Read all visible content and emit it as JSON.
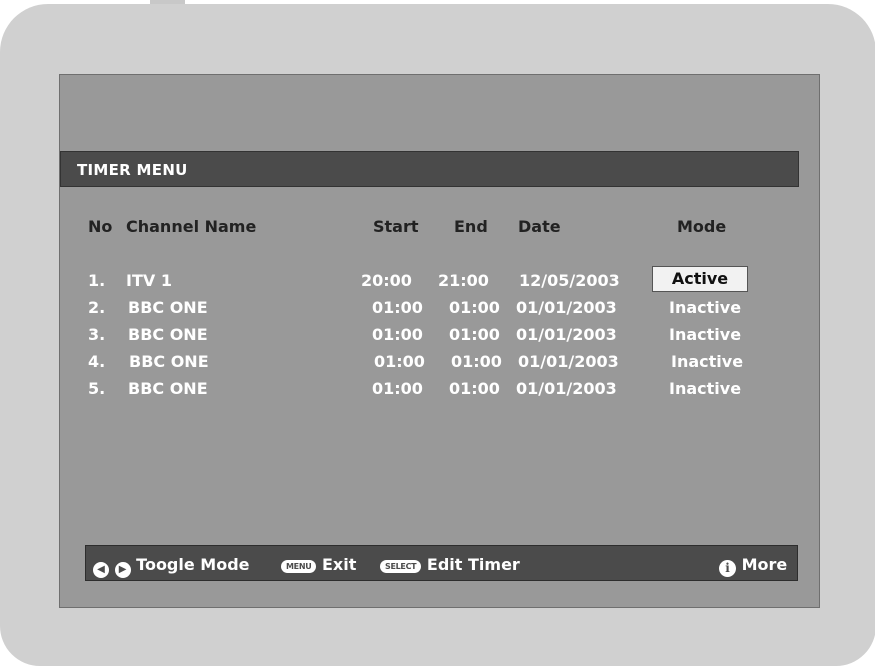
{
  "menu": {
    "title": "TIMER MENU"
  },
  "columns": {
    "no": "No",
    "channel": "Channel Name",
    "start": "Start",
    "end": "End",
    "date": "Date",
    "mode": "Mode"
  },
  "rows": [
    {
      "no": "1.",
      "channel": "ITV 1",
      "start": "20:00",
      "end": "21:00",
      "date": "12/05/2003",
      "mode": "Active"
    },
    {
      "no": "2.",
      "channel": "BBC ONE",
      "start": "01:00",
      "end": "01:00",
      "date": "01/01/2003",
      "mode": "Inactive"
    },
    {
      "no": "3.",
      "channel": "BBC ONE",
      "start": "01:00",
      "end": "01:00",
      "date": "01/01/2003",
      "mode": "Inactive"
    },
    {
      "no": "4.",
      "channel": "BBC ONE",
      "start": "01:00",
      "end": "01:00",
      "date": "01/01/2003",
      "mode": "Inactive"
    },
    {
      "no": "5.",
      "channel": "BBC ONE",
      "start": "01:00",
      "end": "01:00",
      "date": "01/01/2003",
      "mode": "Inactive"
    }
  ],
  "help": {
    "toggle_label": "Toogle Mode",
    "menu_key": "MENU",
    "exit_label": "Exit",
    "select_key": "SELECT",
    "edit_label": "Edit Timer",
    "info_key": "i",
    "more_label": "More"
  },
  "icons": {
    "left": "left-arrow-icon",
    "right": "right-arrow-icon",
    "menu": "menu-button-icon",
    "select": "select-button-icon",
    "info": "info-icon"
  },
  "colors": {
    "frame": "#d0d0d0",
    "screen": "#999999",
    "bar": "#4b4b4b",
    "highlight": "#f2f2f2"
  }
}
